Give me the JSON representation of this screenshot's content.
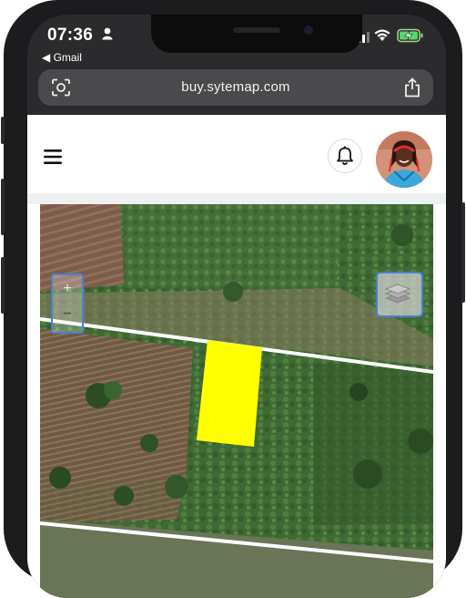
{
  "status_bar": {
    "time": "07:36",
    "back_app": "◀ Gmail"
  },
  "browser": {
    "url": "buy.sytemap.com"
  },
  "app": {
    "menu_icon": "hamburger-icon",
    "notification_icon": "bell-icon",
    "avatar_alt": "user avatar"
  },
  "map": {
    "zoom_in_label": "+",
    "zoom_out_label": "−",
    "layers_icon": "layers-icon",
    "plot_color": "#ffff00",
    "boundary_color": "#ffffff"
  }
}
